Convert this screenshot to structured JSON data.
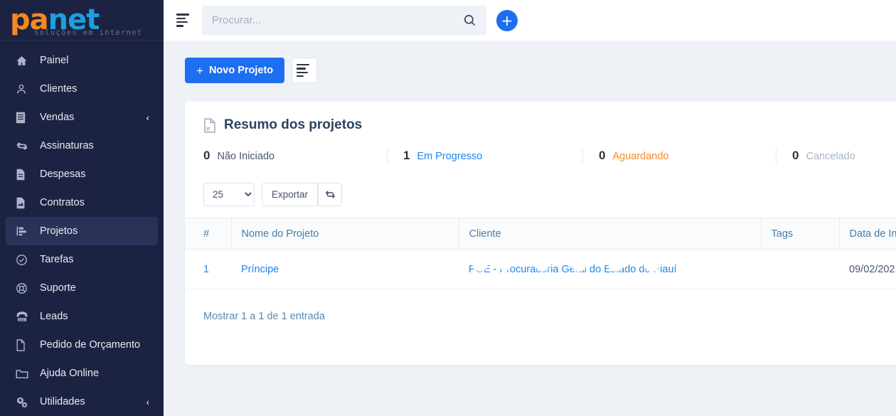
{
  "brand": {
    "name_part1": "pa",
    "name_part2": "net",
    "tagline": "soluções em internet",
    "color_orange": "#f5881f",
    "color_blue": "#1a9fe0",
    "sidebar_bg": "#1c2342"
  },
  "sidebar": {
    "items": [
      {
        "label": "Painel",
        "icon": "home-icon",
        "active": false,
        "caret": ""
      },
      {
        "label": "Clientes",
        "icon": "user-icon",
        "active": false,
        "caret": ""
      },
      {
        "label": "Vendas",
        "icon": "receipt-icon",
        "active": false,
        "caret": "‹"
      },
      {
        "label": "Assinaturas",
        "icon": "refresh-icon",
        "active": false,
        "caret": ""
      },
      {
        "label": "Despesas",
        "icon": "file-icon",
        "active": false,
        "caret": ""
      },
      {
        "label": "Contratos",
        "icon": "contract-icon",
        "active": false,
        "caret": ""
      },
      {
        "label": "Projetos",
        "icon": "project-icon",
        "active": true,
        "caret": ""
      },
      {
        "label": "Tarefas",
        "icon": "check-icon",
        "active": false,
        "caret": ""
      },
      {
        "label": "Suporte",
        "icon": "lifering-icon",
        "active": false,
        "caret": ""
      },
      {
        "label": "Leads",
        "icon": "phone-icon",
        "active": false,
        "caret": ""
      },
      {
        "label": "Pedido de Orçamento",
        "icon": "file-icon",
        "active": false,
        "caret": ""
      },
      {
        "label": "Ajuda Online",
        "icon": "folder-icon",
        "active": false,
        "caret": ""
      },
      {
        "label": "Utilidades",
        "icon": "gears-icon",
        "active": false,
        "caret": "‹"
      }
    ]
  },
  "topbar": {
    "menu_icon": "hamburger-icon",
    "search": {
      "placeholder": "Procurar...",
      "value": "",
      "icon": "search-icon"
    },
    "add_button": {
      "label": "+",
      "icon": "plus-icon",
      "color": "#1d6ff2"
    }
  },
  "toolbar": {
    "new_project_label": "Novo Projeto",
    "new_project_plus": "+",
    "list_view_icon": "list-icon"
  },
  "card": {
    "title": "Resumo dos projetos",
    "title_icon": "document-icon",
    "summary": [
      {
        "count": "0",
        "label": "Não Iniciado",
        "color": "#4c5668"
      },
      {
        "count": "1",
        "label": "Em Progresso",
        "color": "#1d86f2"
      },
      {
        "count": "0",
        "label": "Aguardando",
        "color": "#f58b2c"
      },
      {
        "count": "0",
        "label": "Cancelado",
        "color": "#a9b4c3"
      }
    ],
    "controls": {
      "page_size_value": "25",
      "page_size_options": [
        "25"
      ],
      "export_label": "Exportar",
      "refresh_icon": "refresh-icon"
    },
    "table": {
      "columns": [
        "#",
        "Nome do Projeto",
        "Cliente",
        "Tags",
        "Data de Iní"
      ],
      "rows": [
        {
          "num": "1",
          "project": "Príncipe",
          "client": "PGE - Procuradoria Geral do Estado do Piauí",
          "tags": "",
          "start_date": "09/02/202"
        }
      ]
    },
    "footer": "Mostrar 1 a 1 de 1 entrada"
  }
}
